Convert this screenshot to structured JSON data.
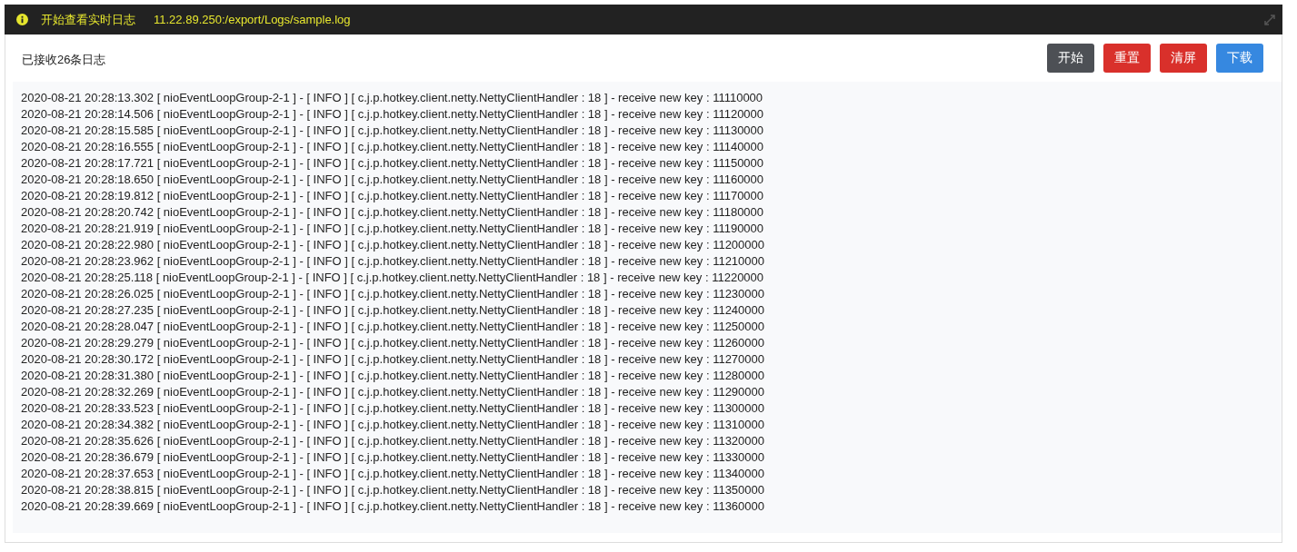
{
  "header": {
    "title": "开始查看实时日志",
    "path": "11.22.89.250:/export/Logs/sample.log"
  },
  "toolbar": {
    "status": "已接收26条日志",
    "buttons": [
      {
        "label": "开始",
        "kind": "dark"
      },
      {
        "label": "重置",
        "kind": "danger"
      },
      {
        "label": "清屏",
        "kind": "danger"
      },
      {
        "label": "下载",
        "kind": "primary"
      }
    ]
  },
  "log_lines": [
    "2020-08-21 20:28:13.302 [ nioEventLoopGroup-2-1 ] - [ INFO ] [ c.j.p.hotkey.client.netty.NettyClientHandler : 18 ] - receive new key : 11110000",
    "2020-08-21 20:28:14.506 [ nioEventLoopGroup-2-1 ] - [ INFO ] [ c.j.p.hotkey.client.netty.NettyClientHandler : 18 ] - receive new key : 11120000",
    "2020-08-21 20:28:15.585 [ nioEventLoopGroup-2-1 ] - [ INFO ] [ c.j.p.hotkey.client.netty.NettyClientHandler : 18 ] - receive new key : 11130000",
    "2020-08-21 20:28:16.555 [ nioEventLoopGroup-2-1 ] - [ INFO ] [ c.j.p.hotkey.client.netty.NettyClientHandler : 18 ] - receive new key : 11140000",
    "2020-08-21 20:28:17.721 [ nioEventLoopGroup-2-1 ] - [ INFO ] [ c.j.p.hotkey.client.netty.NettyClientHandler : 18 ] - receive new key : 11150000",
    "2020-08-21 20:28:18.650 [ nioEventLoopGroup-2-1 ] - [ INFO ] [ c.j.p.hotkey.client.netty.NettyClientHandler : 18 ] - receive new key : 11160000",
    "2020-08-21 20:28:19.812 [ nioEventLoopGroup-2-1 ] - [ INFO ] [ c.j.p.hotkey.client.netty.NettyClientHandler : 18 ] - receive new key : 11170000",
    "2020-08-21 20:28:20.742 [ nioEventLoopGroup-2-1 ] - [ INFO ] [ c.j.p.hotkey.client.netty.NettyClientHandler : 18 ] - receive new key : 11180000",
    "2020-08-21 20:28:21.919 [ nioEventLoopGroup-2-1 ] - [ INFO ] [ c.j.p.hotkey.client.netty.NettyClientHandler : 18 ] - receive new key : 11190000",
    "2020-08-21 20:28:22.980 [ nioEventLoopGroup-2-1 ] - [ INFO ] [ c.j.p.hotkey.client.netty.NettyClientHandler : 18 ] - receive new key : 11200000",
    "2020-08-21 20:28:23.962 [ nioEventLoopGroup-2-1 ] - [ INFO ] [ c.j.p.hotkey.client.netty.NettyClientHandler : 18 ] - receive new key : 11210000",
    "2020-08-21 20:28:25.118 [ nioEventLoopGroup-2-1 ] - [ INFO ] [ c.j.p.hotkey.client.netty.NettyClientHandler : 18 ] - receive new key : 11220000",
    "2020-08-21 20:28:26.025 [ nioEventLoopGroup-2-1 ] - [ INFO ] [ c.j.p.hotkey.client.netty.NettyClientHandler : 18 ] - receive new key : 11230000",
    "2020-08-21 20:28:27.235 [ nioEventLoopGroup-2-1 ] - [ INFO ] [ c.j.p.hotkey.client.netty.NettyClientHandler : 18 ] - receive new key : 11240000",
    "2020-08-21 20:28:28.047 [ nioEventLoopGroup-2-1 ] - [ INFO ] [ c.j.p.hotkey.client.netty.NettyClientHandler : 18 ] - receive new key : 11250000",
    "2020-08-21 20:28:29.279 [ nioEventLoopGroup-2-1 ] - [ INFO ] [ c.j.p.hotkey.client.netty.NettyClientHandler : 18 ] - receive new key : 11260000",
    "2020-08-21 20:28:30.172 [ nioEventLoopGroup-2-1 ] - [ INFO ] [ c.j.p.hotkey.client.netty.NettyClientHandler : 18 ] - receive new key : 11270000",
    "2020-08-21 20:28:31.380 [ nioEventLoopGroup-2-1 ] - [ INFO ] [ c.j.p.hotkey.client.netty.NettyClientHandler : 18 ] - receive new key : 11280000",
    "2020-08-21 20:28:32.269 [ nioEventLoopGroup-2-1 ] - [ INFO ] [ c.j.p.hotkey.client.netty.NettyClientHandler : 18 ] - receive new key : 11290000",
    "2020-08-21 20:28:33.523 [ nioEventLoopGroup-2-1 ] - [ INFO ] [ c.j.p.hotkey.client.netty.NettyClientHandler : 18 ] - receive new key : 11300000",
    "2020-08-21 20:28:34.382 [ nioEventLoopGroup-2-1 ] - [ INFO ] [ c.j.p.hotkey.client.netty.NettyClientHandler : 18 ] - receive new key : 11310000",
    "2020-08-21 20:28:35.626 [ nioEventLoopGroup-2-1 ] - [ INFO ] [ c.j.p.hotkey.client.netty.NettyClientHandler : 18 ] - receive new key : 11320000",
    "2020-08-21 20:28:36.679 [ nioEventLoopGroup-2-1 ] - [ INFO ] [ c.j.p.hotkey.client.netty.NettyClientHandler : 18 ] - receive new key : 11330000",
    "2020-08-21 20:28:37.653 [ nioEventLoopGroup-2-1 ] - [ INFO ] [ c.j.p.hotkey.client.netty.NettyClientHandler : 18 ] - receive new key : 11340000",
    "2020-08-21 20:28:38.815 [ nioEventLoopGroup-2-1 ] - [ INFO ] [ c.j.p.hotkey.client.netty.NettyClientHandler : 18 ] - receive new key : 11350000",
    "2020-08-21 20:28:39.669 [ nioEventLoopGroup-2-1 ] - [ INFO ] [ c.j.p.hotkey.client.netty.NettyClientHandler : 18 ] - receive new key : 11360000"
  ]
}
